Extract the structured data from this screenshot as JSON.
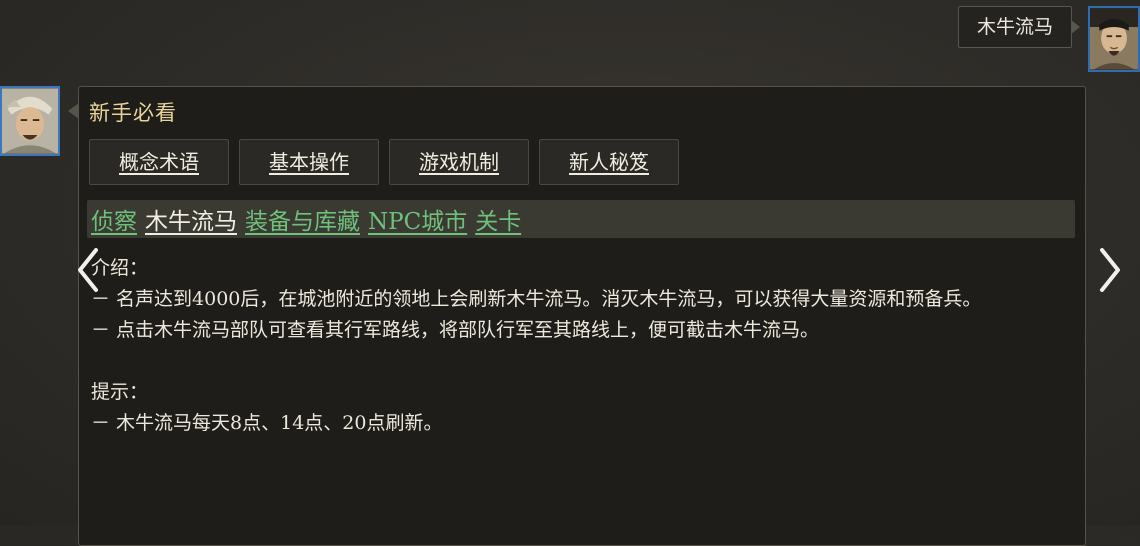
{
  "user_message": {
    "text": "木牛流马"
  },
  "panel": {
    "title": "新手必看",
    "tabs": [
      {
        "label": "概念术语"
      },
      {
        "label": "基本操作"
      },
      {
        "label": "游戏机制"
      },
      {
        "label": "新人秘笈"
      }
    ],
    "subtopics": [
      {
        "label": "侦察",
        "active": false
      },
      {
        "label": "木牛流马",
        "active": true
      },
      {
        "label": "装备与库藏",
        "active": false
      },
      {
        "label": "NPC城市",
        "active": false
      },
      {
        "label": "关卡",
        "active": false
      }
    ],
    "content": {
      "intro_heading": "介绍：",
      "intro_line1": "－ 名声达到4000后，在城池附近的领地上会刷新木牛流马。消灭木牛流马，可以获得大量资源和预备兵。",
      "intro_line2": "－ 点击木牛流马部队可查看其行军路线，将部队行军至其路线上，便可截击木牛流马。",
      "tip_heading": "提示：",
      "tip_line1": "－ 木牛流马每天8点、14点、20点刷新。"
    }
  },
  "colors": {
    "link_green": "#6fc07a",
    "title_gold": "#e8d49a",
    "avatar_border": "#2f6db0"
  },
  "icons": {
    "prev": "chevron-left-icon",
    "next": "chevron-right-icon"
  }
}
